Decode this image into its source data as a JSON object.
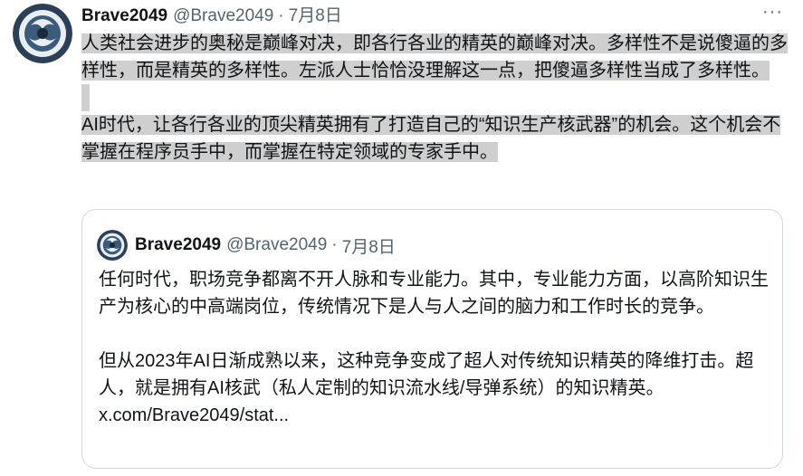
{
  "tweet": {
    "author_name": "Brave2049",
    "handle": "@Brave2049",
    "separator": "·",
    "date": "7月8日",
    "more_icon": "···",
    "paragraph1": "人类社会进步的奥秘是巅峰对决，即各行各业的精英的巅峰对决。多样性不是说傻逼的多样性，而是精英的多样性。左派人士恰恰没理解这一点，把傻逼多样性当成了多样性。",
    "paragraph2": "AI时代，让各行各业的顶尖精英拥有了打造自己的“知识生产核武器”的机会。这个机会不掌握在程序员手中，而掌握在特定领域的专家手中。"
  },
  "quote": {
    "author_name": "Brave2049",
    "handle": "@Brave2049",
    "separator": "·",
    "date": "7月8日",
    "paragraph1": "任何时代，职场竞争都离不开人脉和专业能力。其中，专业能力方面，以高阶知识生产为核心的中高端岗位，传统情况下是人与人之间的脑力和工作时长的竞争。",
    "paragraph2": "但从2023年AI日渐成熟以来，这种竞争变成了超人对传统知识精英的降维打击。超人，就是拥有AI核武（私人定制的知识流水线/导弹系统）的知识精英。",
    "link": "x.com/Brave2049/stat..."
  },
  "colors": {
    "highlight": "#cfcfcf",
    "text": "#0f1419",
    "secondary": "#536471",
    "border": "#cfd9de"
  }
}
